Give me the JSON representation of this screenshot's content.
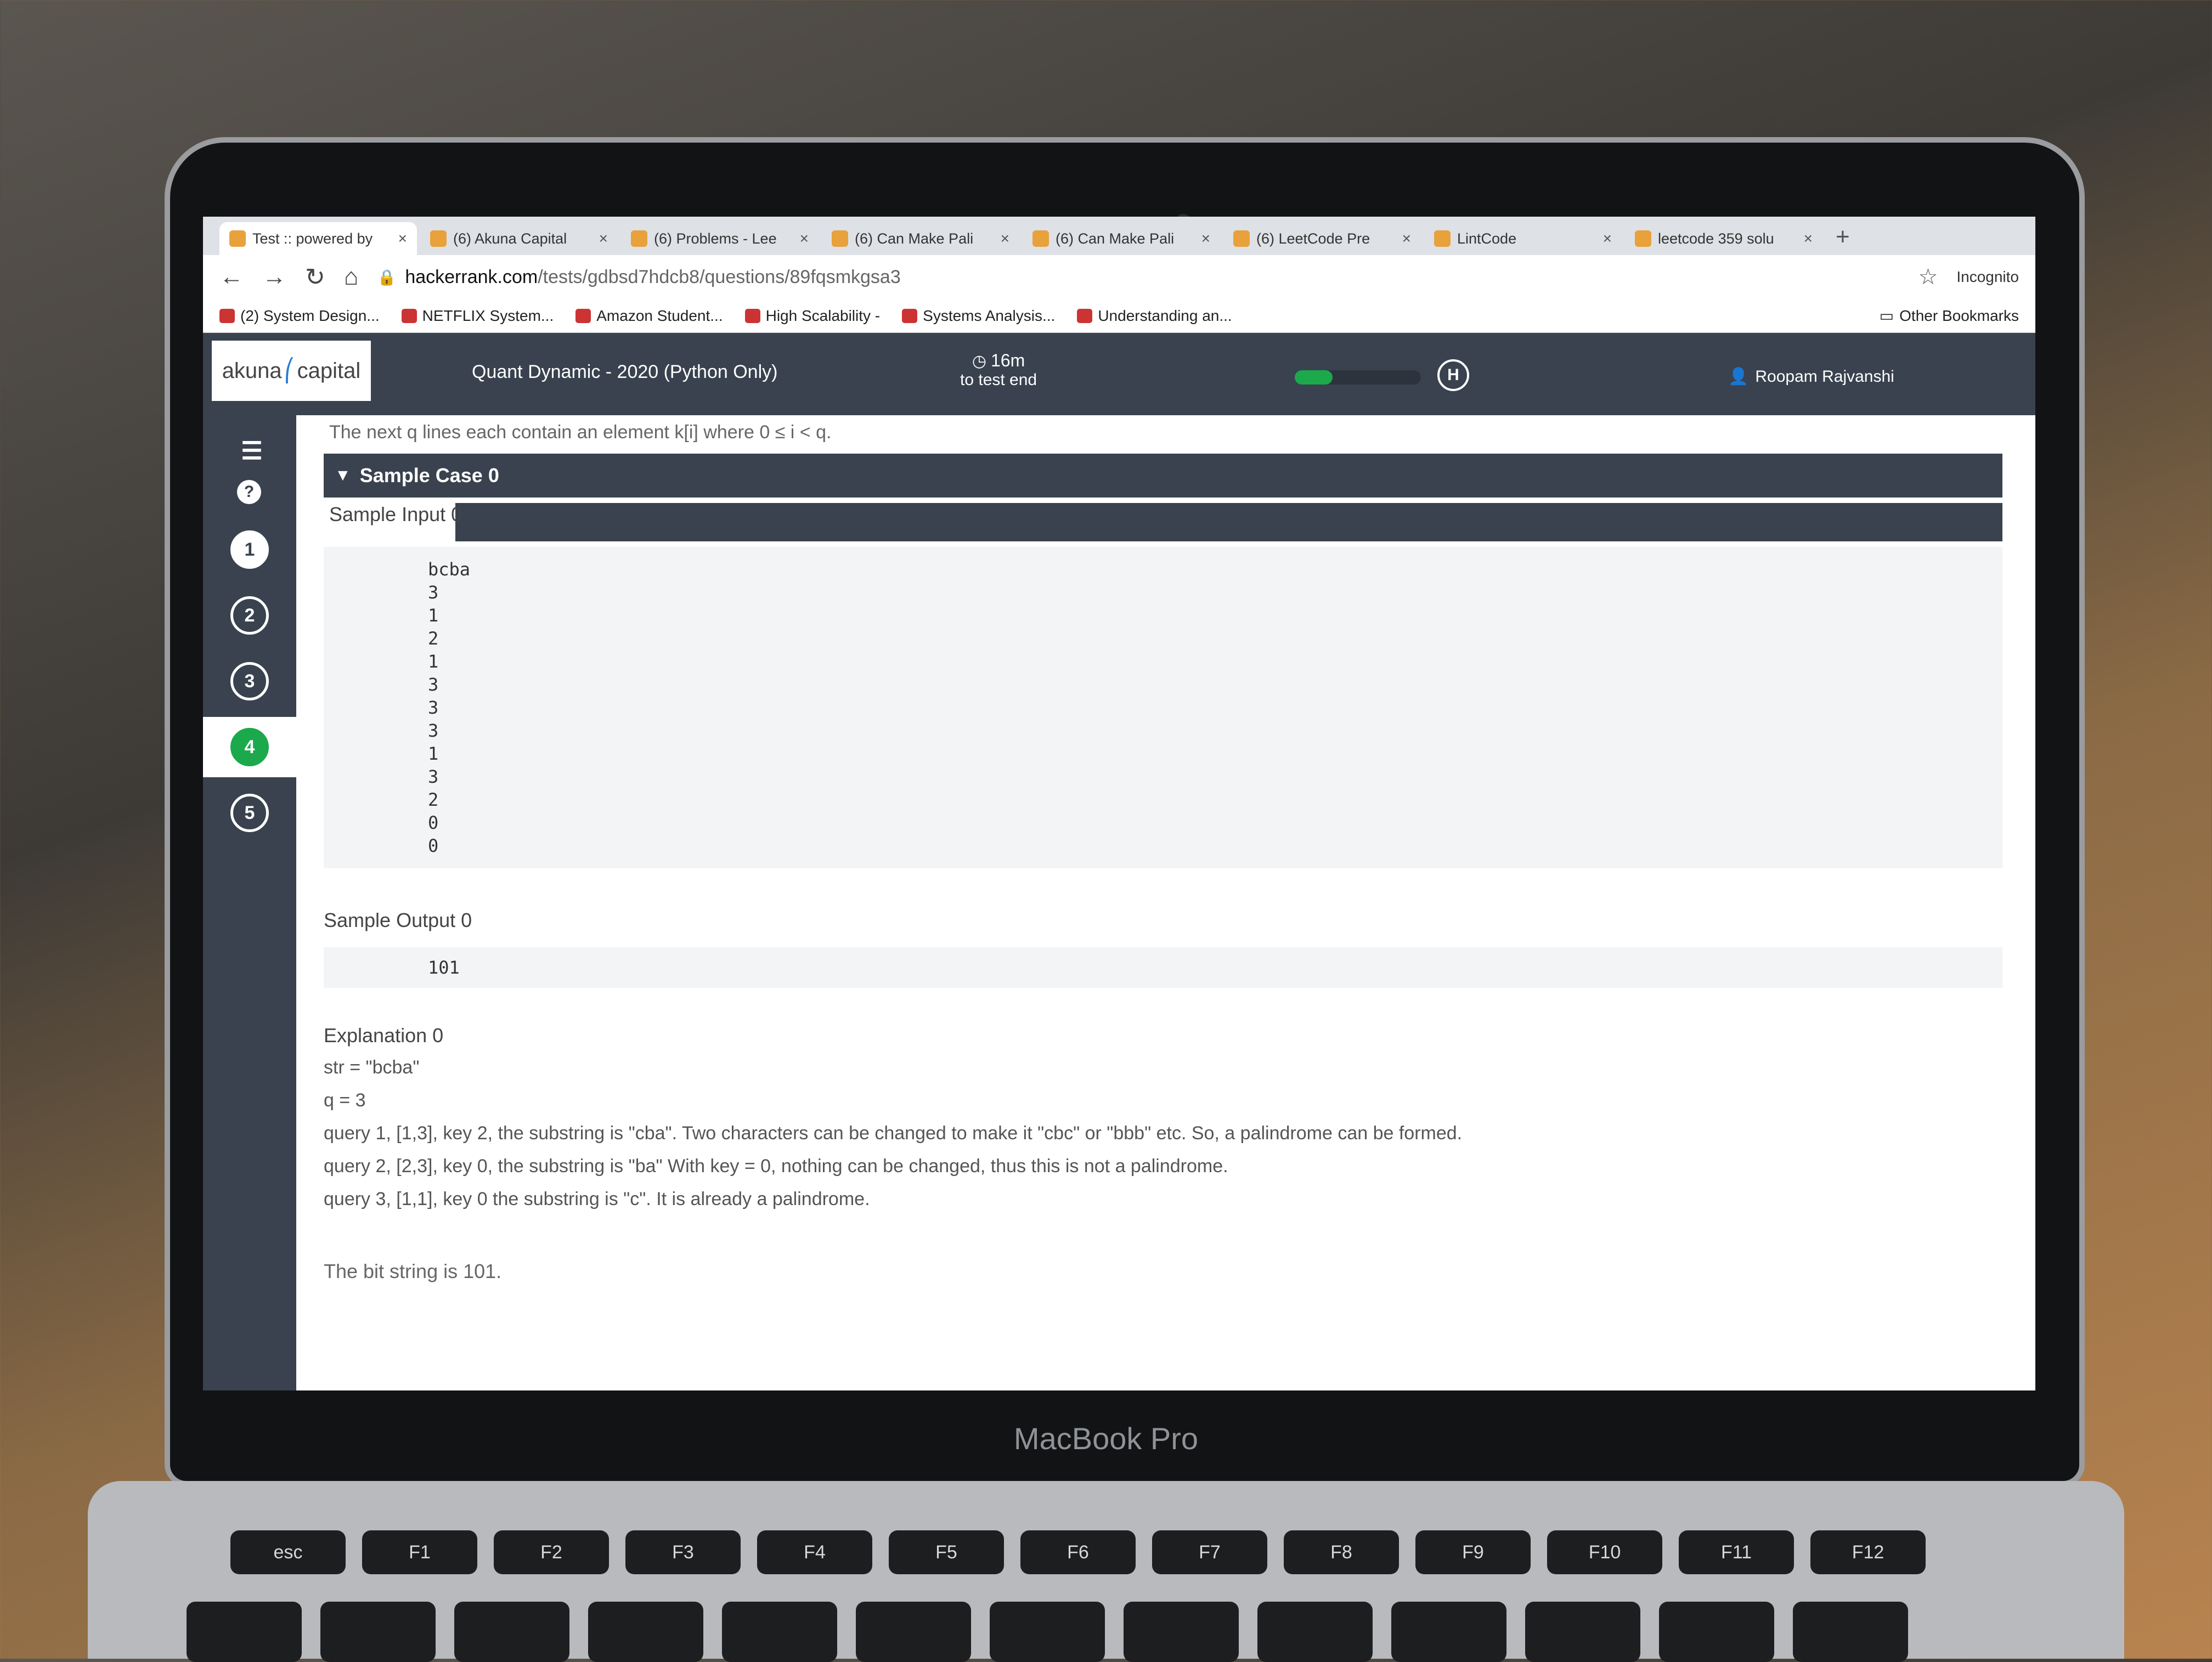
{
  "browser": {
    "tabs": [
      {
        "title": "Test :: powered by",
        "active": true
      },
      {
        "title": "(6) Akuna Capital",
        "active": false
      },
      {
        "title": "(6) Problems - Lee",
        "active": false
      },
      {
        "title": "(6) Can Make Pali",
        "active": false
      },
      {
        "title": "(6) Can Make Pali",
        "active": false
      },
      {
        "title": "(6) LeetCode Pre",
        "active": false
      },
      {
        "title": "LintCode",
        "active": false
      },
      {
        "title": "leetcode 359 solu",
        "active": false
      }
    ],
    "new_tab_label": "+",
    "url_host": "hackerrank.com",
    "url_path": "/tests/gdbsd7hdcb8/questions/89fqsmkgsa3",
    "incognito_label": "Incognito",
    "bookmarks": [
      "(2) System Design...",
      "NETFLIX System...",
      "Amazon Student...",
      "High Scalability -",
      "Systems Analysis...",
      "Understanding an..."
    ],
    "other_bookmarks": "Other Bookmarks"
  },
  "header": {
    "logo_left": "akuna",
    "logo_right": "capital",
    "test_name": "Quant Dynamic - 2020 (Python Only)",
    "timer_value": "16m",
    "timer_caption": "to test end",
    "progress_fraction": 0.3,
    "user_name": "Roopam Rajvanshi"
  },
  "sidebar": {
    "questions": [
      "1",
      "2",
      "3",
      "4",
      "5"
    ],
    "active_question": "4",
    "help_label": "?"
  },
  "problem": {
    "intro_line": "The next q lines each contain an element k[i] where 0 ≤ i < q.",
    "sample_case_title": "Sample Case 0",
    "sample_input_label": "Sample Input 0",
    "sample_input_lines": [
      "bcba",
      "3",
      "1",
      "2",
      "1",
      "3",
      "3",
      "3",
      "1",
      "3",
      "2",
      "0",
      "0"
    ],
    "sample_output_label": "Sample Output 0",
    "sample_output": "101",
    "explanation_label": "Explanation 0",
    "explanation_lines": [
      "str = \"bcba\"",
      "q = 3",
      "query 1, [1,3], key 2, the substring is \"cba\". Two characters can be changed to make it \"cbc\" or \"bbb\" etc. So, a palindrome can be formed.",
      "query 2, [2,3], key 0, the substring is \"ba\" With key = 0, nothing can be changed, thus this is not a palindrome.",
      "query 3, [1,1], key 0 the substring is \"c\". It is already a palindrome."
    ],
    "bit_string_line": "The bit string is 101."
  },
  "device": {
    "label": "MacBook Pro",
    "keys": [
      "esc",
      "F1",
      "F2",
      "F3",
      "F4",
      "F5",
      "F6",
      "F7",
      "F8",
      "F9",
      "F10",
      "F11",
      "F12"
    ]
  }
}
